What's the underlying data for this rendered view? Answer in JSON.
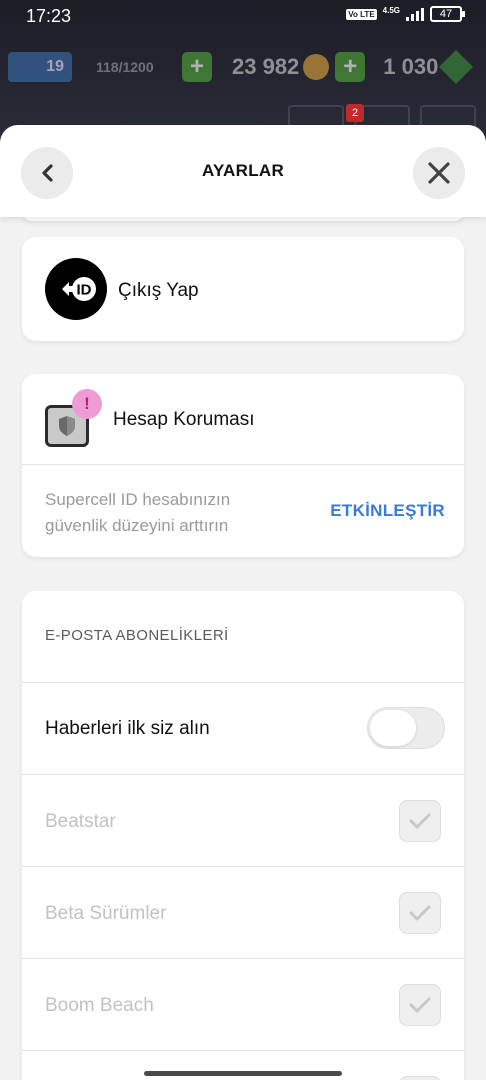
{
  "status_bar": {
    "time": "17:23",
    "network": "4.5G",
    "volte": "Vo LTE",
    "battery": "47"
  },
  "game_hud": {
    "level": "19",
    "xp": "118/1200",
    "gold": "23 982",
    "gems": "1 030",
    "badge": "2"
  },
  "header": {
    "title": "AYARLAR"
  },
  "logout": {
    "label": "Çıkış Yap"
  },
  "account_protection": {
    "label": "Hesap Koruması",
    "alert": "!",
    "description": "Supercell ID hesabınızın güvenlik düzeyini arttırın",
    "action": "ETKİNLEŞTİR",
    "action_color": "#3a7bd5"
  },
  "email_subscriptions": {
    "heading": "E-POSTA ABONELİKLERİ",
    "news": {
      "label": "Haberleri ilk siz alın",
      "enabled": false
    },
    "items": [
      {
        "label": "Beatstar",
        "checked": true
      },
      {
        "label": "Beta Sürümler",
        "checked": true
      },
      {
        "label": "Boom Beach",
        "checked": true
      }
    ]
  }
}
